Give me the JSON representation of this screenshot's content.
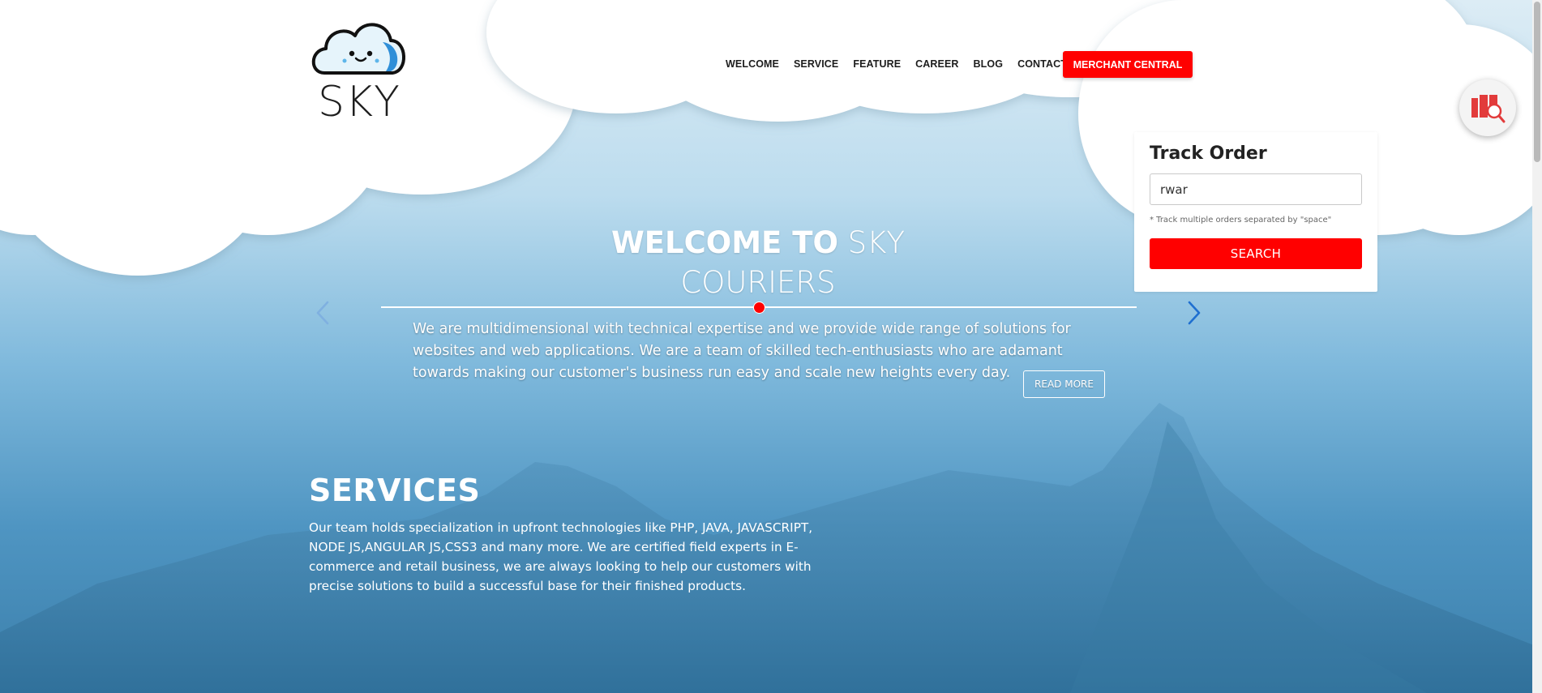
{
  "brand": {
    "logo_text": "SKY"
  },
  "nav": {
    "items": [
      "WELCOME",
      "SERVICE",
      "FEATURE",
      "CAREER",
      "BLOG",
      "CONTACT"
    ],
    "merchant_button": "MERCHANT CENTRAL"
  },
  "track_order": {
    "title": "Track Order",
    "input_value": "rwar",
    "hint": "* Track multiple orders separated by \"space\"",
    "search_button": "SEARCH"
  },
  "hero": {
    "title_bold": "WELCOME TO",
    "title_light_1": "SKY",
    "title_light_2": "COURIERS",
    "body": "We are multidimensional with technical expertise and we provide wide range of solutions for websites and web applications. We are a team of skilled tech-enthusiasts who are adamant towards making our customer's business run easy and scale new heights every day.",
    "read_more": "READ MORE"
  },
  "services": {
    "title": "SERVICES",
    "body": "Our team holds specialization in upfront technologies like PHP, JAVA, JAVASCRIPT, NODE JS,ANGULAR JS,CSS3 and many more. We are certified field experts in E-commerce and retail business, we are always looking to help our customers with precise solutions to build a successful base for their finished products."
  },
  "colors": {
    "accent": "#ff0000",
    "text_dark": "#1d1d1d",
    "arrow_blue": "#2a7fd4"
  },
  "icons": [
    "cloud-logo-icon",
    "track-search-icon",
    "chevron-left-icon",
    "chevron-right-icon"
  ]
}
